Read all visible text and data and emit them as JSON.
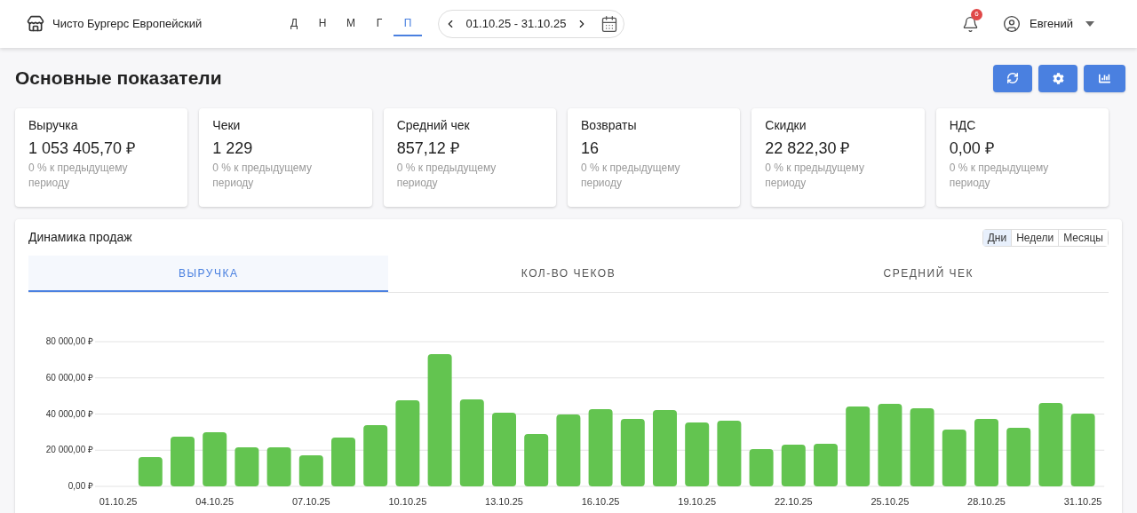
{
  "header": {
    "store": "Чисто Бургерс Европейский",
    "periods": [
      {
        "label": "Д",
        "selected": false
      },
      {
        "label": "Н",
        "selected": false
      },
      {
        "label": "М",
        "selected": false
      },
      {
        "label": "Г",
        "selected": false
      },
      {
        "label": "П",
        "selected": true
      }
    ],
    "date_range": "01.10.25 - 31.10.25",
    "notifications": "6",
    "user": "Евгений"
  },
  "page_title": "Основные показатели",
  "kpis": [
    {
      "title": "Выручка",
      "value": "1 053 405,70 ₽",
      "change": "0 % к предыдущему периоду"
    },
    {
      "title": "Чеки",
      "value": "1 229",
      "change": "0 % к предыдущему периоду"
    },
    {
      "title": "Средний чек",
      "value": "857,12 ₽",
      "change": "0 % к предыдущему периоду"
    },
    {
      "title": "Возвраты",
      "value": "16",
      "change": "0 % к предыдущему периоду"
    },
    {
      "title": "Скидки",
      "value": "22 822,30 ₽",
      "change": "0 % к предыдущему периоду"
    },
    {
      "title": "НДС",
      "value": "0,00 ₽",
      "change": "0 % к предыдущему периоду"
    }
  ],
  "sales_panel": {
    "title": "Динамика продаж",
    "granularity": [
      {
        "label": "Дни",
        "selected": true
      },
      {
        "label": "Недели",
        "selected": false
      },
      {
        "label": "Месяцы",
        "selected": false
      }
    ],
    "tabs": [
      {
        "label": "ВЫРУЧКА",
        "selected": true
      },
      {
        "label": "КОЛ-ВО ЧЕКОВ",
        "selected": false
      },
      {
        "label": "СРЕДНИЙ ЧЕК",
        "selected": false
      }
    ],
    "chart_data": {
      "type": "bar",
      "categories": [
        "01.10.25",
        null,
        null,
        "04.10.25",
        null,
        null,
        "07.10.25",
        null,
        null,
        "10.10.25",
        null,
        null,
        "13.10.25",
        null,
        null,
        "16.10.25",
        null,
        null,
        "19.10.25",
        null,
        null,
        "22.10.25",
        null,
        null,
        "25.10.25",
        null,
        null,
        "28.10.25",
        null,
        null,
        "31.10.25"
      ],
      "grid": true,
      "series": [
        {
          "color": "#63c450",
          "values": [
            null,
            16200,
            27500,
            30000,
            21600,
            21600,
            17200,
            27000,
            33900,
            47600,
            73100,
            48100,
            40700,
            29000,
            39700,
            42700,
            37300,
            42200,
            35300,
            36300,
            20600,
            23100,
            23600,
            44200,
            45600,
            43200,
            31400,
            37300,
            32400,
            46100,
            40200
          ]
        }
      ],
      "ylim": [
        0,
        80000
      ],
      "yticks": [
        {
          "value": 0,
          "label": "0,00 ₽"
        },
        {
          "value": 20000,
          "label": "20 000,00 ₽"
        },
        {
          "value": 40000,
          "label": "40 000,00 ₽"
        },
        {
          "value": 60000,
          "label": "60 000,00 ₽"
        },
        {
          "value": 80000,
          "label": "80 000,00 ₽"
        }
      ]
    }
  }
}
